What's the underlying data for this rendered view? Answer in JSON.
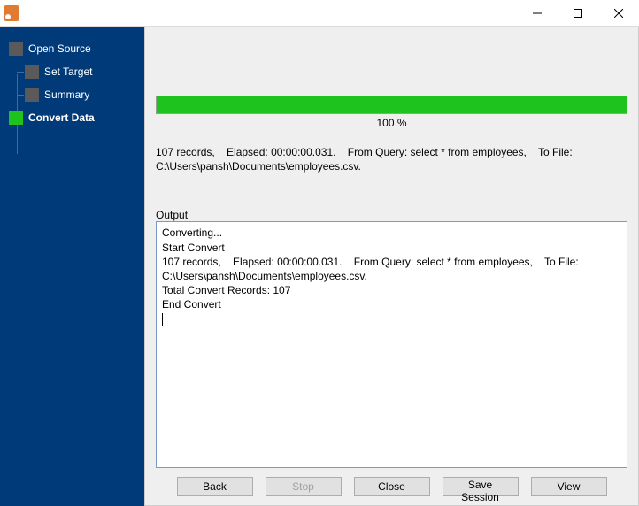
{
  "window": {
    "title": ""
  },
  "sidebar": {
    "items": [
      {
        "label": "Open Source",
        "active": false,
        "child": false
      },
      {
        "label": "Set Target",
        "active": false,
        "child": true
      },
      {
        "label": "Summary",
        "active": false,
        "child": true
      },
      {
        "label": "Convert Data",
        "active": true,
        "child": false
      }
    ]
  },
  "progress": {
    "percent_text": "100 %",
    "percent_value": 100
  },
  "stats_text": "107 records,    Elapsed: 00:00:00.031.    From Query: select * from employees,    To File: C:\\Users\\pansh\\Documents\\employees.csv.",
  "output": {
    "label": "Output",
    "lines": [
      "Converting...",
      "Start Convert",
      "107 records,    Elapsed: 00:00:00.031.    From Query: select * from employees,    To File: C:\\Users\\pansh\\Documents\\employees.csv.",
      "Total Convert Records: 107",
      "End Convert"
    ]
  },
  "buttons": {
    "back": "Back",
    "stop": "Stop",
    "close": "Close",
    "save_session": "Save Session",
    "view": "View"
  }
}
